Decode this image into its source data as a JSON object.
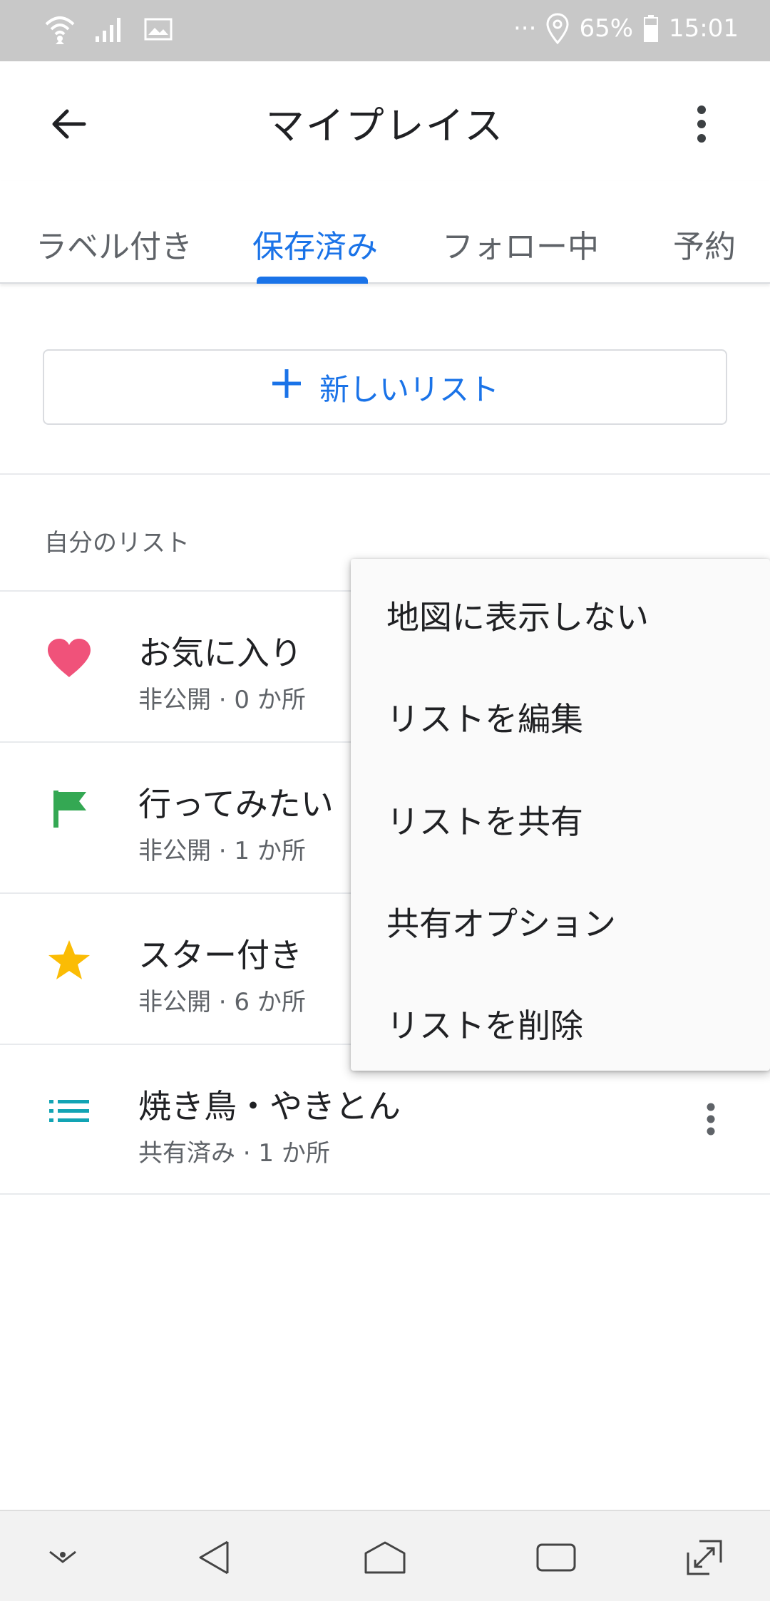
{
  "status_bar": {
    "icons": [
      "wifi-icon",
      "signal-icon",
      "image-icon"
    ],
    "more": "···",
    "location_icon": "location-pin-icon",
    "battery_percent": "65%",
    "battery_level": 0.65,
    "time": "15:01"
  },
  "app_bar": {
    "back_icon": "arrow-back-icon",
    "title": "マイプレイス",
    "more_icon": "more-vert-icon"
  },
  "tabs": [
    {
      "label": "ラベル付き",
      "active": false
    },
    {
      "label": "保存済み",
      "active": true
    },
    {
      "label": "フォロー中",
      "active": false
    },
    {
      "label": "予約",
      "active": false
    }
  ],
  "accent_color": "#1a73e8",
  "new_list": {
    "icon": "plus-icon",
    "label": "新しいリスト"
  },
  "section": {
    "title": "自分のリスト"
  },
  "lists": [
    {
      "icon": "heart-icon",
      "icon_color": "#f0527a",
      "title": "お気に入り",
      "subtitle": "非公開 · 0 か所"
    },
    {
      "icon": "flag-icon",
      "icon_color": "#34a853",
      "title": "行ってみたい",
      "subtitle": "非公開 · 1 か所"
    },
    {
      "icon": "star-icon",
      "icon_color": "#fbbc04",
      "title": "スター付き",
      "subtitle": "非公開 · 6 か所"
    },
    {
      "icon": "list-icon",
      "icon_color": "#12a4b4",
      "title": "焼き鳥・やきとん",
      "subtitle": "共有済み · 1 か所"
    }
  ],
  "menu": {
    "items": [
      "地図に表示しない",
      "リストを編集",
      "リストを共有",
      "共有オプション",
      "リストを削除"
    ]
  },
  "nav_bar": {
    "icons": [
      "hide-keyboard-icon",
      "back-triangle-icon",
      "home-icon",
      "recents-icon",
      "rotate-screen-icon"
    ]
  }
}
